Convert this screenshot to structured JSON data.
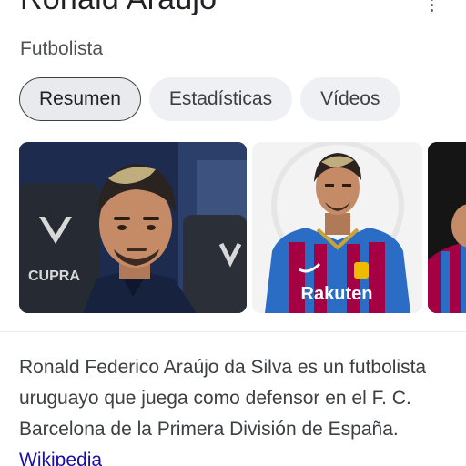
{
  "header": {
    "title": "Ronald Araújo",
    "subtitle": "Futbolista",
    "menu_icon": "more-vert-icon"
  },
  "tabs": [
    {
      "label": "Resumen",
      "active": true
    },
    {
      "label": "Estadísticas",
      "active": false
    },
    {
      "label": "Vídeos",
      "active": false
    }
  ],
  "images": {
    "jersey_sponsor": "Rakuten",
    "seat_brand": "CUPRA"
  },
  "description": {
    "text": "Ronald Federico Araújo da Silva es un futbolista uruguayo que juega como defensor en el F. C. Barcelona de la Primera División de España.",
    "source_link": "Wikipedia"
  },
  "colors": {
    "link": "#1a0dab",
    "chip_bg": "#eef0f3",
    "jersey_red": "#a50044",
    "jersey_blue": "#2b6cc4"
  }
}
